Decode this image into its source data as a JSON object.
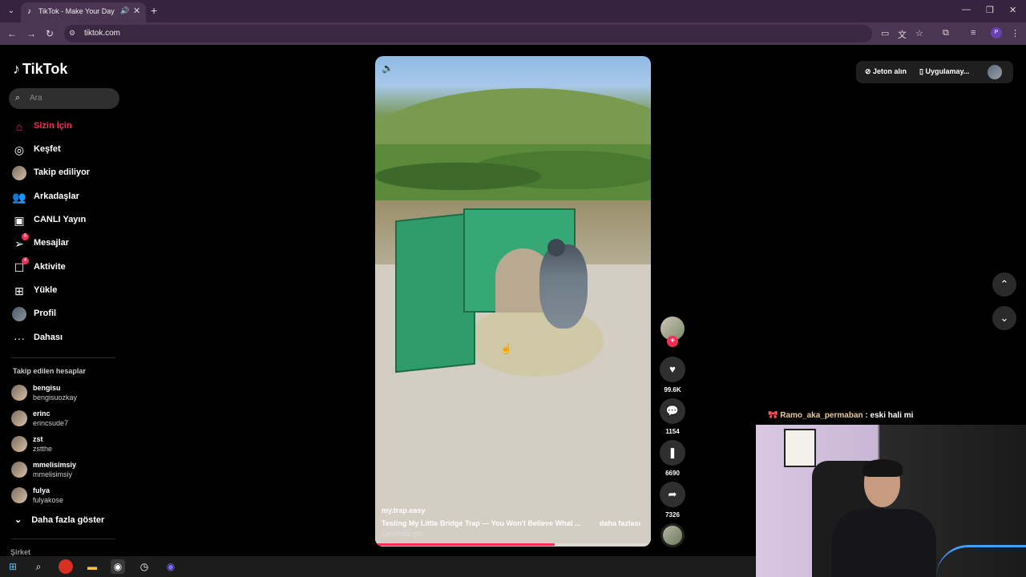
{
  "browser": {
    "tab_title": "TikTok - Make Your Day",
    "url": "tiktok.com",
    "tab_list_icon": "chevron-down-icon",
    "new_tab_icon": "plus-icon",
    "profile_initial": "P"
  },
  "sidebar": {
    "logo": "TikTok",
    "search_placeholder": "Ara",
    "nav": [
      {
        "label": "Sizin İçin",
        "icon": "home-icon",
        "active": true
      },
      {
        "label": "Keşfet",
        "icon": "compass-icon"
      },
      {
        "label": "Takip ediliyor",
        "icon": "avatar-icon"
      },
      {
        "label": "Arkadaşlar",
        "icon": "users-icon"
      },
      {
        "label": "CANLI Yayın",
        "icon": "live-icon"
      },
      {
        "label": "Mesajlar",
        "icon": "message-icon",
        "badge": "5"
      },
      {
        "label": "Aktivite",
        "icon": "activity-icon",
        "badge": "4"
      },
      {
        "label": "Yükle",
        "icon": "upload-icon"
      },
      {
        "label": "Profil",
        "icon": "profile-avatar-icon"
      },
      {
        "label": "Dahası",
        "icon": "more-icon"
      }
    ],
    "followed_title": "Takip edilen hesaplar",
    "accounts": [
      {
        "name": "bengisu",
        "handle": "bengisuozkay"
      },
      {
        "name": "erinc",
        "handle": "erincsude7"
      },
      {
        "name": "zst",
        "handle": "zstthe"
      },
      {
        "name": "mmelisimsiy",
        "handle": "mmelisimsiy"
      },
      {
        "name": "fulya",
        "handle": "fulyakose"
      }
    ],
    "show_more": "Daha fazla göster",
    "company": "Şirket"
  },
  "video": {
    "username": "my.trap.easy",
    "caption": "Testing My Little Bridge Trap — You Won't Believe What ...",
    "more_label": "daha fazlası",
    "translate_label": "Çevirisini gör",
    "progress": 0.65
  },
  "actions": {
    "likes": "99.6K",
    "comments": "1154",
    "saves": "6690",
    "shares": "7326"
  },
  "top_right": {
    "coins_label": "Jeton alın",
    "app_label": "Uygulamay..."
  },
  "stream": {
    "chat_user": "Ramo_aka_permaban",
    "chat_message": " : eski hali mi"
  },
  "colors": {
    "accent": "#fe2c55",
    "chrome": "#35233f"
  }
}
